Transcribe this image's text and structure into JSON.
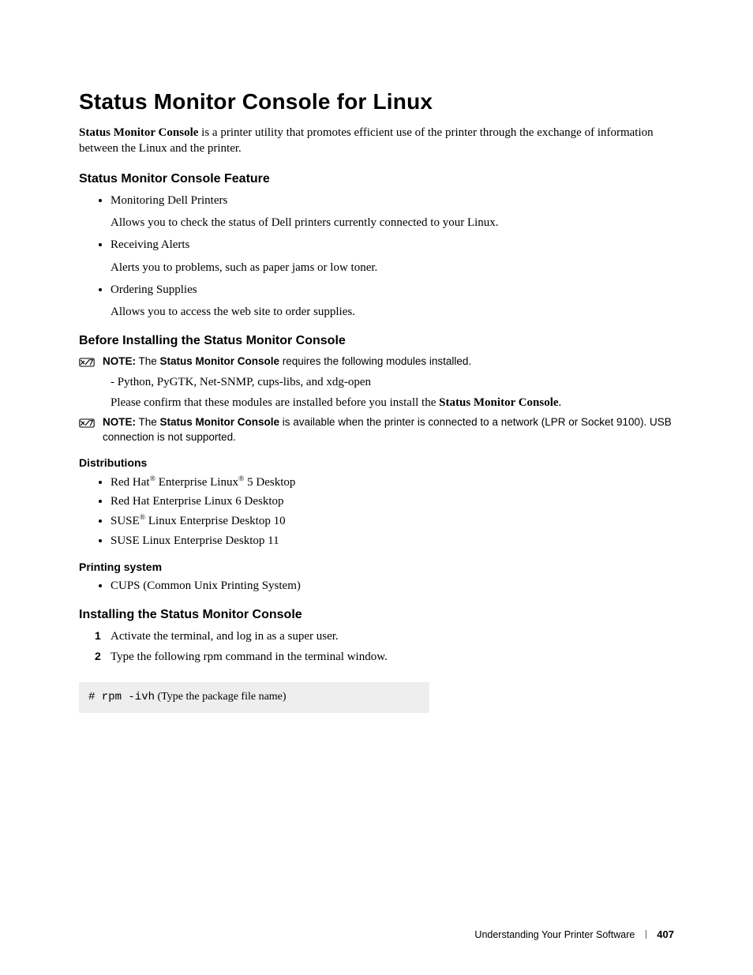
{
  "title": "Status Monitor Console for Linux",
  "intro_prefix_bold": "Status Monitor Console",
  "intro_rest": " is a printer utility that promotes efficient use of the printer through the exchange of information between the Linux and the printer.",
  "section_feature": "Status Monitor Console Feature",
  "features": [
    {
      "head": "Monitoring Dell Printers",
      "desc": "Allows you to check the status of Dell printers currently connected to your Linux."
    },
    {
      "head": "Receiving Alerts",
      "desc": "Alerts you to problems, such as paper jams or low toner."
    },
    {
      "head": "Ordering Supplies",
      "desc": "Allows you to access the web site to order supplies."
    }
  ],
  "section_before": "Before Installing the Status Monitor Console",
  "note1": {
    "label": "NOTE:",
    "pre": " The ",
    "bold": "Status Monitor Console",
    "post": " requires the following modules installed."
  },
  "modules_line": "- Python, PyGTK, Net-SNMP, cups-libs, and xdg-open",
  "confirm_pre": "Please confirm that these modules are installed before you install the ",
  "confirm_bold": "Status Monitor Console",
  "confirm_post": ".",
  "note2": {
    "label": "NOTE:",
    "pre": " The ",
    "bold": "Status Monitor Console",
    "post": " is available when the printer is connected to a network (LPR or Socket 9100). USB connection is not supported."
  },
  "dist_heading": "Distributions",
  "distributions_html": [
    "Red Hat<sup class='reg'>®</sup> Enterprise Linux<sup class='reg'>®</sup> 5 Desktop",
    "Red Hat Enterprise Linux 6 Desktop",
    "SUSE<sup class='reg'>®</sup> Linux Enterprise Desktop 10",
    "SUSE Linux Enterprise Desktop 11"
  ],
  "printsys_heading": "Printing system",
  "printsys_item": "CUPS (Common Unix Printing System)",
  "section_install": "Installing the Status Monitor Console",
  "steps": [
    "Activate the terminal, and log in as a super user.",
    "Type the following rpm command in the terminal window."
  ],
  "code_cmd": "# rpm -ivh",
  "code_note": " (Type the package file name)",
  "footer_text": "Understanding Your Printer Software",
  "page_number": "407"
}
